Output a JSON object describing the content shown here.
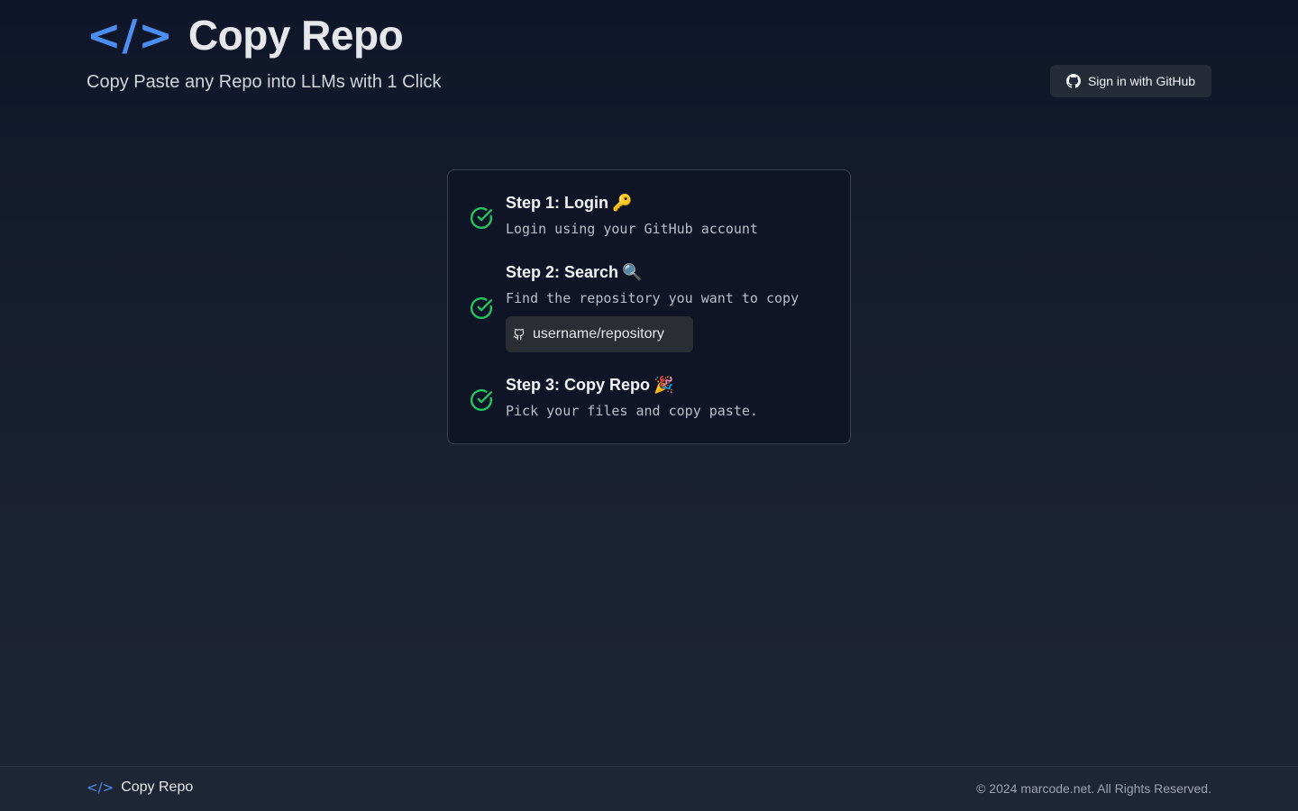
{
  "header": {
    "logo_code": "</>",
    "title": "Copy Repo",
    "tagline": "Copy Paste any Repo into LLMs with 1 Click"
  },
  "auth": {
    "signin_label": "Sign in with GitHub"
  },
  "steps": [
    {
      "title": "Step 1: Login",
      "emoji": "🔑",
      "description": "Login using your GitHub account",
      "status": "complete"
    },
    {
      "title": "Step 2: Search",
      "emoji": "🔍",
      "description": "Find the repository you want to copy",
      "status": "complete"
    },
    {
      "title": "Step 3: Copy Repo",
      "emoji": "🎉",
      "description": "Pick your files and copy paste.",
      "status": "complete"
    }
  ],
  "search": {
    "placeholder": "username/repository"
  },
  "footer": {
    "logo_code": "</>",
    "brand": "Copy Repo",
    "copyright": "© 2024 marcode.net. All Rights Reserved."
  },
  "colors": {
    "accent": "#4c8ef0",
    "check": "#22c55e",
    "background": "#171e2f"
  }
}
